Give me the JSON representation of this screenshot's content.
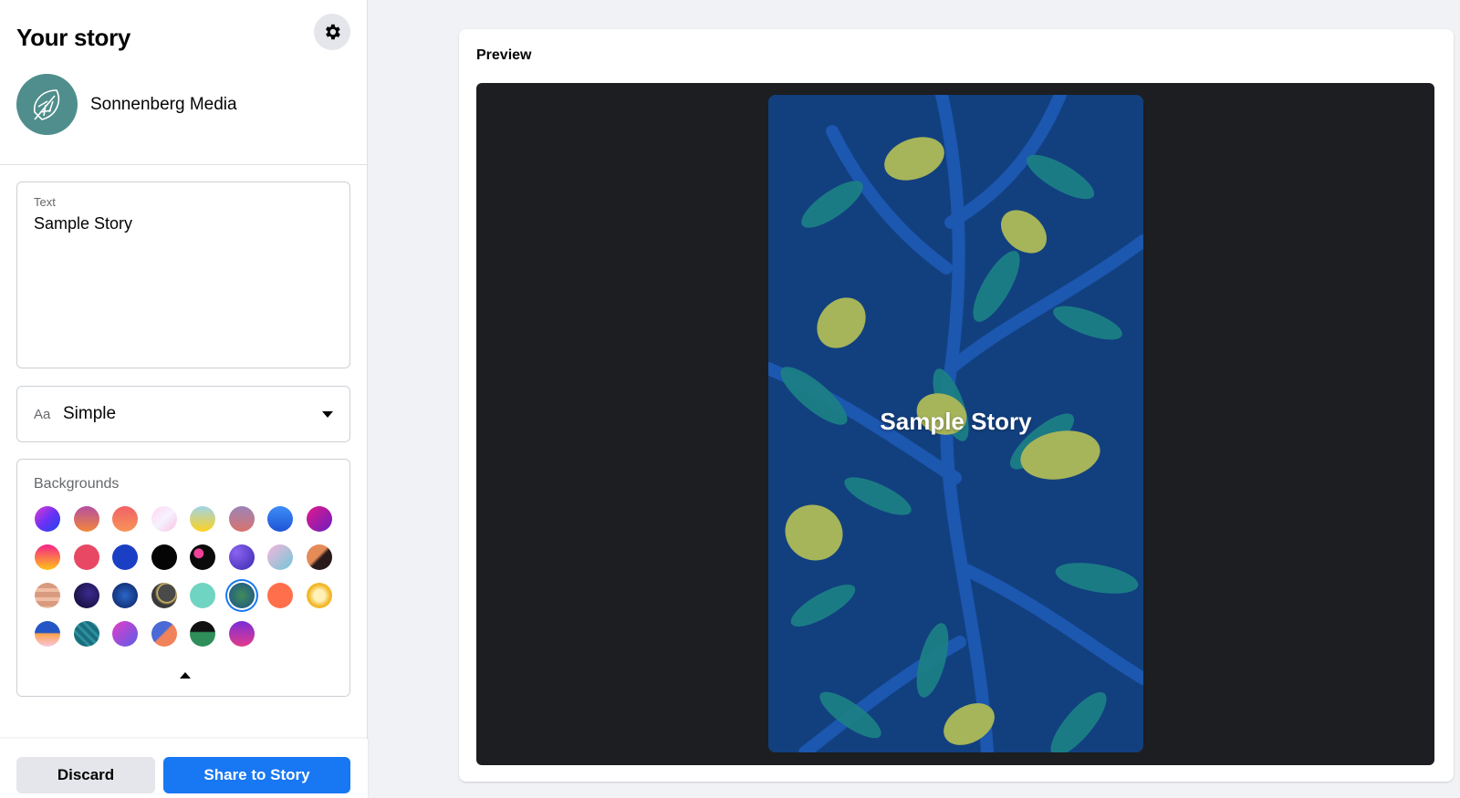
{
  "sidebar": {
    "title": "Your story",
    "settings_icon": "gear-icon",
    "profile": {
      "name": "Sonnenberg Media",
      "avatar_icon": "leaf-logo-icon"
    },
    "text_field": {
      "label": "Text",
      "value": "Sample Story"
    },
    "font_select": {
      "prefix": "Aa",
      "value": "Simple"
    },
    "backgrounds": {
      "label": "Backgrounds",
      "selected_index": 21,
      "swatches": [
        "linear-gradient(135deg,#e23dd0,#6b31f5 50%,#1e49e8)",
        "linear-gradient(180deg,#b44fa0,#f2873b)",
        "linear-gradient(180deg,#f06167,#f89457)",
        "linear-gradient(135deg,#ffd6f1,#f6f2ff 50%,#f9c0e0)",
        "linear-gradient(180deg,#9fd4e6,#ffd21f)",
        "linear-gradient(180deg,#9b84b8,#d9736c)",
        "linear-gradient(180deg,#3e8df8,#1e54d6)",
        "linear-gradient(135deg,#e4188d,#6a1fbd)",
        "linear-gradient(180deg,#f4228a,#ffc317)",
        "#e84864",
        "#1b3fc4",
        "#050505",
        "radial-gradient(circle at 35% 35%,#f0409a 20%,#0a0a0a 22%)",
        "radial-gradient(circle at 30% 30%,#8b63f0,#3a2ab0)",
        "linear-gradient(135deg,#f7b6da,#6fc7d8)",
        "linear-gradient(135deg,#e58b58 45%,#2a1a1a 55%)",
        "repeating-linear-gradient(180deg,#d99b7f 0 6px,#f0bda6 6px 10px)",
        "radial-gradient(circle at 60% 40%,#3b2a8f,#0d0a2a)",
        "radial-gradient(circle,#2a66c8,#0b1f5c)",
        "radial-gradient(circle at 60% 40%,#4a4a4a 40%,#e0c56a 42%,#3a3a3a 55%)",
        "#6fd4c1",
        "radial-gradient(circle,#3f8d5a,#1d4f8a)",
        "#ff6f4b",
        "radial-gradient(circle,#fff1b8 30%,#f2b829 60%)",
        "linear-gradient(180deg,#2457c5 45%,#ffa34d 50%,#f7c6e2)",
        "repeating-linear-gradient(45deg,#1a6e7c 0 4px,#2b8fa0 4px 7px)",
        "linear-gradient(135deg,#e43dc8,#5a5de8)",
        "linear-gradient(135deg,#4b6ad6 45%,#f0835a 50%)",
        "linear-gradient(180deg,#111 40%,#2f8f5a 45%)",
        "linear-gradient(180deg,#7a2dd8,#e43b8a)"
      ]
    },
    "buttons": {
      "discard": "Discard",
      "share": "Share to Story"
    }
  },
  "preview": {
    "title": "Preview",
    "story_text": "Sample Story"
  }
}
